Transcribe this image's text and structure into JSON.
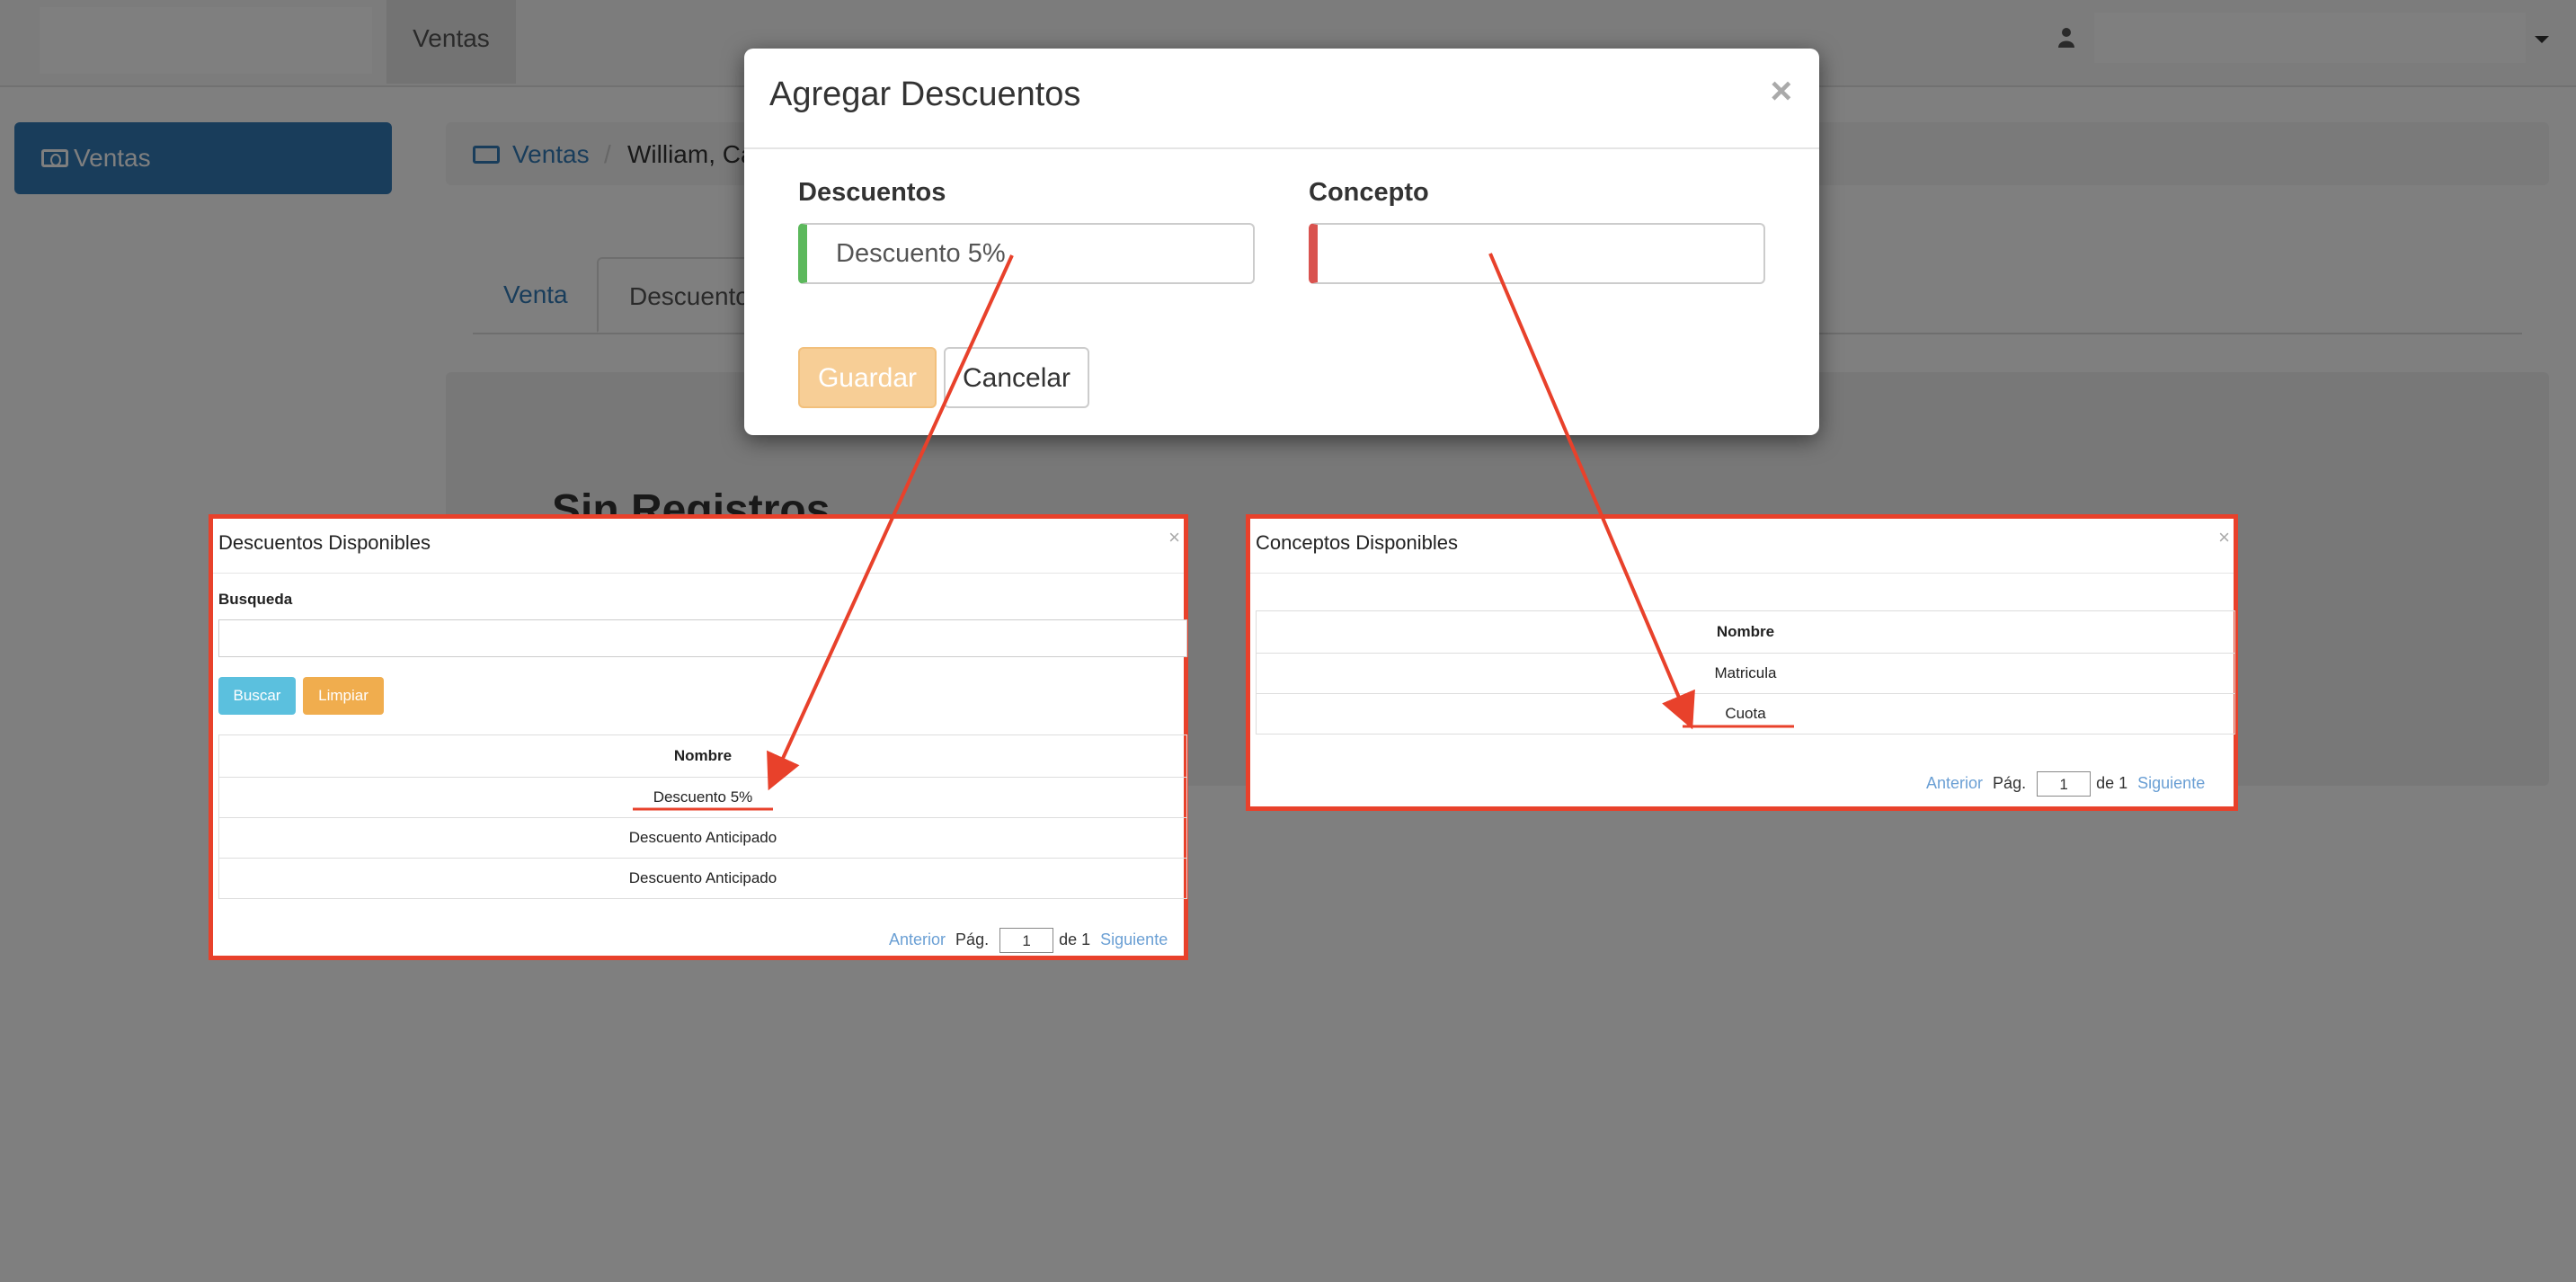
{
  "navbar": {
    "tab_ventas": "Ventas"
  },
  "sidebar": {
    "active_item": "Ventas"
  },
  "breadcrumb": {
    "link": "Ventas",
    "separator": "/",
    "current": "William, Ca"
  },
  "tabs": [
    "Venta",
    "Descuento"
  ],
  "content": {
    "empty_message": "Sin Registros"
  },
  "modal": {
    "title": "Agregar Descuentos",
    "close": "×",
    "descuentos_label": "Descuentos",
    "descuentos_value": "Descuento 5%",
    "concepto_label": "Concepto",
    "concepto_value": "",
    "save_label": "Guardar",
    "cancel_label": "Cancelar"
  },
  "descuentos_popup": {
    "title": "Descuentos Disponibles",
    "close": "×",
    "search_label": "Busqueda",
    "search_value": "",
    "buscar_label": "Buscar",
    "limpiar_label": "Limpiar",
    "column_header": "Nombre",
    "rows": [
      "Descuento 5%",
      "Descuento Anticipado",
      "Descuento Anticipado"
    ],
    "pager": {
      "prev": "Anterior",
      "page_label": "Pág.",
      "page": "1",
      "of": "de 1",
      "next": "Siguiente"
    }
  },
  "conceptos_popup": {
    "title": "Conceptos Disponibles",
    "close": "×",
    "column_header": "Nombre",
    "rows": [
      "Matricula",
      "Cuota"
    ],
    "pager": {
      "prev": "Anterior",
      "page_label": "Pág.",
      "page": "1",
      "of": "de 1",
      "next": "Siguiente"
    }
  },
  "colors": {
    "annotation": "#e8412b",
    "primary": "#337ab7",
    "success": "#5cb85c",
    "danger": "#d9534f"
  }
}
